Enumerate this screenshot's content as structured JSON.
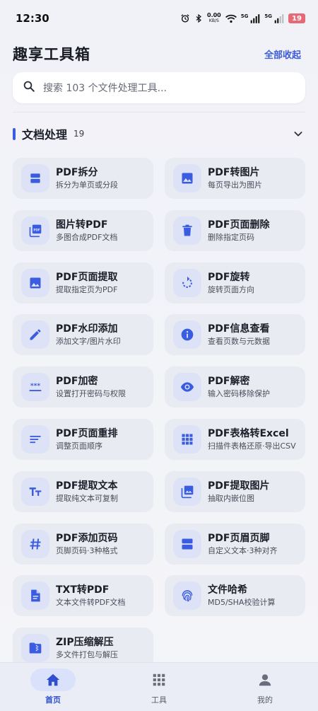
{
  "status": {
    "time": "12:30",
    "net_speed": "0.00",
    "net_unit": "KB/S",
    "signal1": "5G",
    "signal2": "5G",
    "battery": "19"
  },
  "header": {
    "title": "趣享工具箱",
    "collapse_label": "全部收起"
  },
  "search": {
    "placeholder": "搜索 103 个文件处理工具..."
  },
  "section": {
    "title": "文档处理",
    "count": "19"
  },
  "tools": [
    {
      "name": "PDF拆分",
      "desc": "拆分为单页或分段",
      "icon": "split-icon"
    },
    {
      "name": "PDF转图片",
      "desc": "每页导出为图片",
      "icon": "image-icon"
    },
    {
      "name": "图片转PDF",
      "desc": "多图合成PDF文档",
      "icon": "pdf-icon"
    },
    {
      "name": "PDF页面删除",
      "desc": "删除指定页码",
      "icon": "trash-icon"
    },
    {
      "name": "PDF页面提取",
      "desc": "提取指定页为PDF",
      "icon": "image-icon"
    },
    {
      "name": "PDF旋转",
      "desc": "旋转页面方向",
      "icon": "rotate-icon"
    },
    {
      "name": "PDF水印添加",
      "desc": "添加文字/图片水印",
      "icon": "pencil-icon"
    },
    {
      "name": "PDF信息查看",
      "desc": "查看页数与元数据",
      "icon": "info-icon"
    },
    {
      "name": "PDF加密",
      "desc": "设置打开密码与权限",
      "icon": "password-icon"
    },
    {
      "name": "PDF解密",
      "desc": "输入密码移除保护",
      "icon": "eye-icon"
    },
    {
      "name": "PDF页面重排",
      "desc": "调整页面顺序",
      "icon": "reorder-icon"
    },
    {
      "name": "PDF表格转Excel",
      "desc": "扫描件表格还原·导出CSV",
      "icon": "grid-icon"
    },
    {
      "name": "PDF提取文本",
      "desc": "提取纯文本可复制",
      "icon": "text-icon"
    },
    {
      "name": "PDF提取图片",
      "desc": "抽取内嵌位图",
      "icon": "photo-library-icon"
    },
    {
      "name": "PDF添加页码",
      "desc": "页脚页码·3种格式",
      "icon": "hash-icon"
    },
    {
      "name": "PDF页眉页脚",
      "desc": "自定义文本·3种对齐",
      "icon": "header-footer-icon"
    },
    {
      "name": "TXT转PDF",
      "desc": "文本文件转PDF文档",
      "icon": "document-icon"
    },
    {
      "name": "文件哈希",
      "desc": "MD5/SHA校验计算",
      "icon": "fingerprint-icon"
    },
    {
      "name": "ZIP压缩解压",
      "desc": "多文件打包与解压",
      "icon": "zip-folder-icon"
    }
  ],
  "nav": [
    {
      "label": "首页",
      "icon": "home-icon",
      "active": true
    },
    {
      "label": "工具",
      "icon": "apps-icon",
      "active": false
    },
    {
      "label": "我的",
      "icon": "person-icon",
      "active": false
    }
  ],
  "colors": {
    "accent": "#3a5ce0",
    "card": "#e9ebf3",
    "icon_bg": "#dde2f6",
    "battery": "#e56a76"
  }
}
